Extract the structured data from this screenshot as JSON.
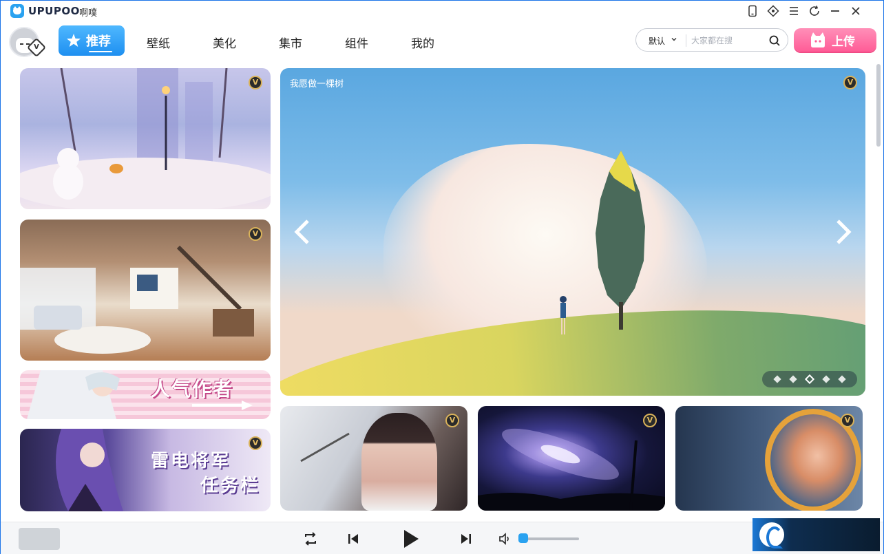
{
  "app": {
    "brand": "UPUPOO",
    "brand_cn": "啊噗"
  },
  "titlebar_icons": [
    "tablet-icon",
    "diamond-icon",
    "menu-icon",
    "refresh-icon",
    "minimize-icon",
    "close-icon"
  ],
  "nav": {
    "tabs": [
      {
        "label": "推荐",
        "active": true
      },
      {
        "label": "壁纸"
      },
      {
        "label": "美化"
      },
      {
        "label": "集市"
      },
      {
        "label": "组件"
      },
      {
        "label": "我的"
      }
    ]
  },
  "search": {
    "sort_value": "默认",
    "placeholder": "大家都在搜"
  },
  "upload_label": "上传",
  "avatar_badge": "V",
  "left_cards": {
    "author_title": "人气作者",
    "raiden_line1": "雷电将军",
    "raiden_line2": "任务栏"
  },
  "banner": {
    "title": "我愿做一棵树",
    "slide_count": 5,
    "active_slide": 3
  },
  "vip_badge": "V",
  "colors": {
    "accent": "#1e8ff0",
    "upload": "#ff5c97",
    "vip_gold": "#d9b25a"
  },
  "player": {
    "volume": 0.05
  }
}
